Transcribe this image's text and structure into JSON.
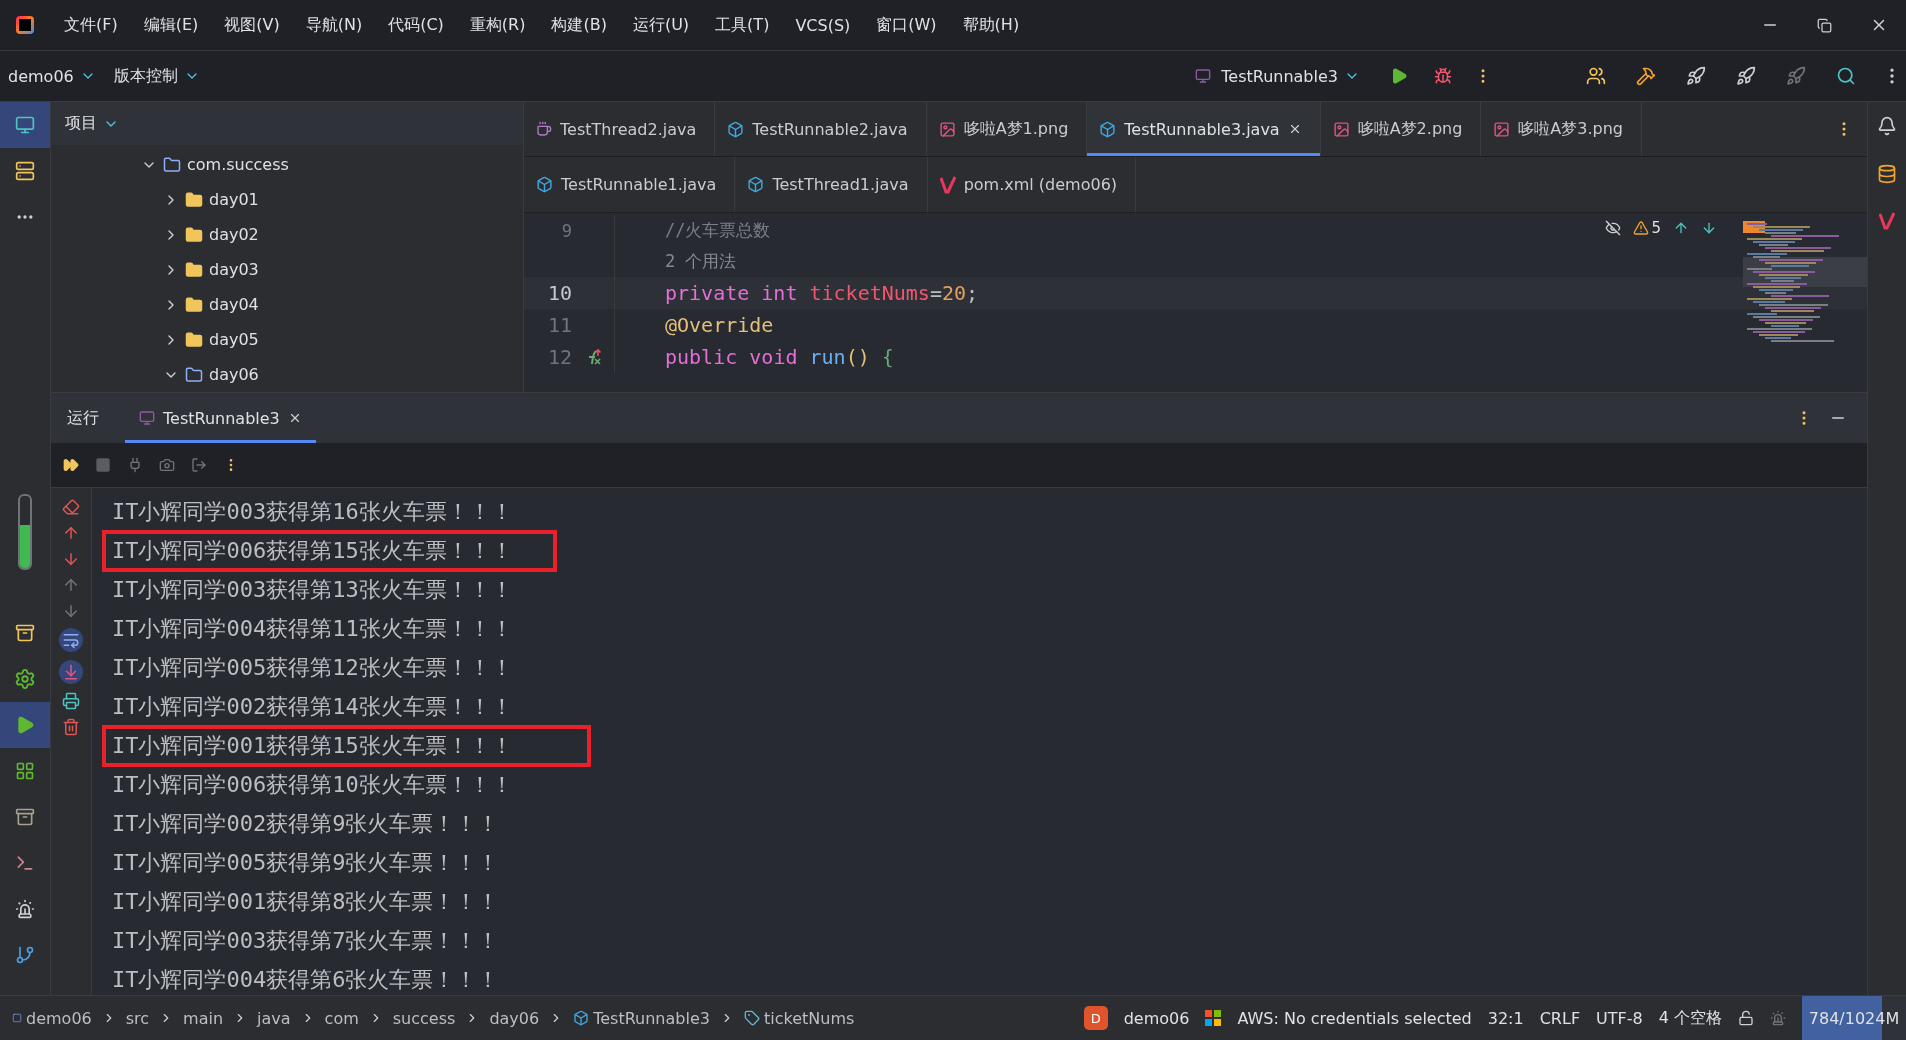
{
  "menu": [
    "文件(F)",
    "编辑(E)",
    "视图(V)",
    "导航(N)",
    "代码(C)",
    "重构(R)",
    "构建(B)",
    "运行(U)",
    "工具(T)",
    "VCS(S)",
    "窗口(W)",
    "帮助(H)"
  ],
  "toolbar": {
    "project": "demo06",
    "vcs": "版本控制",
    "run_config": "TestRunnable3"
  },
  "project_panel": {
    "title": "项目",
    "tree": [
      {
        "label": "com.success",
        "expanded": true,
        "children": [
          {
            "label": "day01",
            "expanded": false
          },
          {
            "label": "day02",
            "expanded": false
          },
          {
            "label": "day03",
            "expanded": false
          },
          {
            "label": "day04",
            "expanded": false
          },
          {
            "label": "day05",
            "expanded": false
          },
          {
            "label": "day06",
            "expanded": true
          }
        ]
      }
    ]
  },
  "editor_tabs": [
    [
      {
        "label": "TestThread2.java",
        "kind": "java",
        "selected": false
      },
      {
        "label": "TestRunnable2.java",
        "kind": "class",
        "selected": false
      },
      {
        "label": "哆啦A梦1.png",
        "kind": "image",
        "selected": false
      },
      {
        "label": "TestRunnable3.java",
        "kind": "class",
        "selected": true
      },
      {
        "label": "哆啦A梦2.png",
        "kind": "image",
        "selected": false
      },
      {
        "label": "哆啦A梦3.png",
        "kind": "image",
        "selected": false
      }
    ],
    [
      {
        "label": "TestRunnable1.java",
        "kind": "class",
        "selected": false
      },
      {
        "label": "TestThread1.java",
        "kind": "class",
        "selected": false
      },
      {
        "label": "pom.xml (demo06)",
        "kind": "maven",
        "selected": false
      }
    ]
  ],
  "editor": {
    "warnings": "5",
    "lines": [
      {
        "number": "9",
        "current": false,
        "override": false,
        "tokens": [
          {
            "kind": "comment",
            "text": "//火车票总数"
          }
        ]
      },
      {
        "current": false,
        "override": false,
        "tokens": [
          {
            "kind": "hint",
            "text": "2 个用法"
          }
        ]
      },
      {
        "number": "10",
        "current": true,
        "override": false,
        "tokens": [
          {
            "kind": "keyword",
            "text": "private "
          },
          {
            "kind": "keyword",
            "text": "int "
          },
          {
            "kind": "field",
            "text": "ticketNums"
          },
          {
            "kind": "plain",
            "text": "="
          },
          {
            "kind": "number",
            "text": "20"
          },
          {
            "kind": "plain",
            "text": ";"
          }
        ]
      },
      {
        "number": "11",
        "current": false,
        "override": false,
        "tokens": [
          {
            "kind": "annotation",
            "text": "@Override"
          }
        ]
      },
      {
        "number": "12",
        "current": false,
        "override": true,
        "tokens": [
          {
            "kind": "keyword",
            "text": "public "
          },
          {
            "kind": "keyword",
            "text": "void "
          },
          {
            "kind": "method",
            "text": "run"
          },
          {
            "kind": "paren",
            "text": "() "
          },
          {
            "kind": "brace",
            "text": "{"
          }
        ]
      }
    ]
  },
  "run_panel": {
    "title": "运行",
    "tabs": [
      {
        "label": "TestRunnable3",
        "selected": true
      }
    ],
    "console": [
      {
        "text": "IT小辉同学003获得第16张火车票！！！",
        "boxed": false
      },
      {
        "text": "IT小辉同学006获得第15张火车票！！！",
        "boxed": true
      },
      {
        "text": "IT小辉同学003获得第13张火车票！！！",
        "boxed": false
      },
      {
        "text": "IT小辉同学004获得第11张火车票！！！",
        "boxed": false
      },
      {
        "text": "IT小辉同学005获得第12张火车票！！！",
        "boxed": false
      },
      {
        "text": "IT小辉同学002获得第14张火车票！！！",
        "boxed": false
      },
      {
        "text": "IT小辉同学001获得第15张火车票！！！",
        "boxed": true
      },
      {
        "text": "IT小辉同学006获得第10张火车票！！！",
        "boxed": false
      },
      {
        "text": "IT小辉同学002获得第9张火车票！！！",
        "boxed": false
      },
      {
        "text": "IT小辉同学005获得第9张火车票！！！",
        "boxed": false
      },
      {
        "text": "IT小辉同学001获得第8张火车票！！！",
        "boxed": false
      },
      {
        "text": "IT小辉同学003获得第7张火车票！！！",
        "boxed": false
      },
      {
        "text": "IT小辉同学004获得第6张火车票！！！",
        "boxed": false
      }
    ]
  },
  "status_bar": {
    "breadcrumbs": [
      {
        "label": "demo06",
        "kind": "module"
      },
      {
        "label": "src",
        "kind": "folder"
      },
      {
        "label": "main",
        "kind": "folder"
      },
      {
        "label": "java",
        "kind": "folder"
      },
      {
        "label": "com",
        "kind": "folder"
      },
      {
        "label": "success",
        "kind": "folder"
      },
      {
        "label": "day06",
        "kind": "folder"
      },
      {
        "label": "TestRunnable3",
        "kind": "class"
      },
      {
        "label": "ticketNums",
        "kind": "field"
      }
    ],
    "project_badge": "D",
    "project": "demo06",
    "aws": "AWS: No credentials selected",
    "position": "32:1",
    "line_ending": "CRLF",
    "encoding": "UTF-8",
    "indent": "4 个空格",
    "memory": {
      "text": "784/1024M",
      "level": 0.77
    }
  }
}
